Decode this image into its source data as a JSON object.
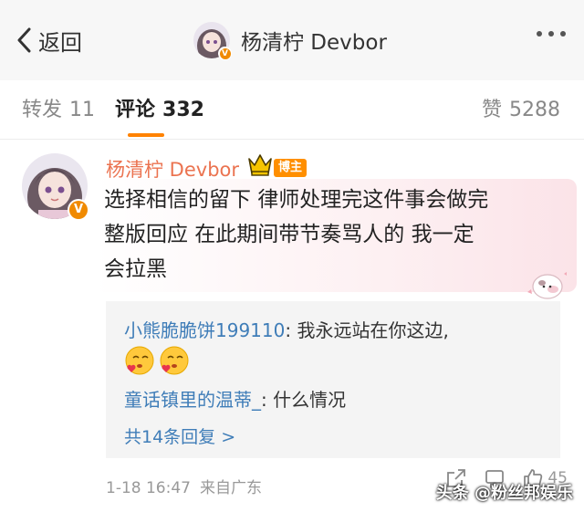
{
  "header": {
    "back_label": "返回",
    "title": "杨清柠 Devbor"
  },
  "tabs": [
    {
      "label": "转发",
      "count": "11"
    },
    {
      "label": "评论",
      "count": "332"
    },
    {
      "label": "赞",
      "count": "5288"
    }
  ],
  "comment": {
    "author": "杨清柠 Devbor",
    "badge": "博主",
    "text_line1": "选择相信的留下 律师处理完这件事会做完",
    "text_line2": "整版回应 在此期间带节奏骂人的 我一定",
    "text_line3": "会拉黑",
    "replies": [
      {
        "user": "小熊脆脆饼199110",
        "text": ": 我永远站在你这边,"
      },
      {
        "user": "童话镇里的温蒂_",
        "text": ": 什么情况"
      }
    ],
    "more_replies": "共14条回复 >",
    "time": "1-18 16:47",
    "source": "来自广东",
    "like_count": "45"
  },
  "watermark": "头条 @粉丝邦娱乐",
  "colors": {
    "username": "#eb7350",
    "link": "#3f7db8",
    "accent": "#ff8200"
  },
  "icons": [
    "chevron-left-icon",
    "more-dots-icon",
    "verified-v-icon",
    "crown-icon",
    "kiss-emoji-icon",
    "cow-sticker-icon",
    "share-icon",
    "reply-icon",
    "like-thumb-icon"
  ]
}
